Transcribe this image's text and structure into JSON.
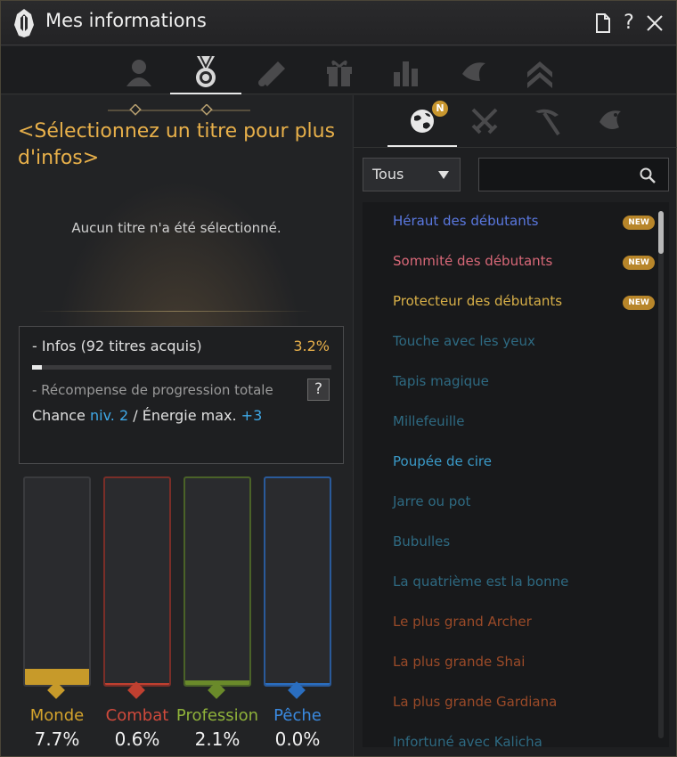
{
  "window": {
    "title": "Mes informations"
  },
  "main_tabs": [
    {
      "icon": "person-icon"
    },
    {
      "icon": "medal-icon",
      "active": true
    },
    {
      "icon": "scroll-icon"
    },
    {
      "icon": "gift-icon"
    },
    {
      "icon": "bar-chart-icon"
    },
    {
      "icon": "fish-hook-icon"
    },
    {
      "icon": "rank-chevron-icon"
    }
  ],
  "left": {
    "heading": "<Sélectionnez un titre pour plus d'infos>",
    "none_selected": "Aucun titre n'a été sélectionné.",
    "info_label": "- Infos (92 titres acquis)",
    "info_percent": "3.2%",
    "progress": 0.032,
    "reward_label": "- Récompense de progression totale",
    "help": "?",
    "reward_prefix": "Chance ",
    "reward_luck": "niv. 2",
    "reward_middle": " / Énergie max. ",
    "reward_energy": "+3"
  },
  "categories": [
    {
      "name": "Monde",
      "percent": "7.7%",
      "value": 7.7,
      "color": "#d4a32c",
      "fill": "#c79a2a",
      "border": "#3a3b3e"
    },
    {
      "name": "Combat",
      "percent": "0.6%",
      "value": 0.6,
      "color": "#d04a3c",
      "fill": "#c04030",
      "border": "#7a2e28"
    },
    {
      "name": "Profession",
      "percent": "2.1%",
      "value": 2.1,
      "color": "#8fb23a",
      "fill": "#6a8a2a",
      "border": "#4a6228"
    },
    {
      "name": "Pêche",
      "percent": "0.0%",
      "value": 0.0,
      "color": "#3a8ae0",
      "fill": "#2a6ec0",
      "border": "#2a5a9a"
    }
  ],
  "right": {
    "sub_tabs": [
      {
        "icon": "globe-icon",
        "badge": "N",
        "active": true
      },
      {
        "icon": "crossed-swords-icon"
      },
      {
        "icon": "pickaxe-icon"
      },
      {
        "icon": "fish-icon"
      }
    ],
    "filter_value": "Tous",
    "search_placeholder": "",
    "items": [
      {
        "label": "Héraut des débutants",
        "color": "#5a78e0",
        "new": "NEW"
      },
      {
        "label": "Sommité des débutants",
        "color": "#d86878",
        "new": "NEW"
      },
      {
        "label": "Protecteur des débutants",
        "color": "#d8b048",
        "new": "NEW"
      },
      {
        "label": "Touche avec les yeux",
        "color": "#2e6a82"
      },
      {
        "label": "Tapis magique",
        "color": "#2e6a82"
      },
      {
        "label": "Millefeuille",
        "color": "#2e6a82"
      },
      {
        "label": "Poupée de cire",
        "color": "#3a9ac8"
      },
      {
        "label": "Jarre ou pot",
        "color": "#2e6a82"
      },
      {
        "label": "Bubulles",
        "color": "#2e6a82"
      },
      {
        "label": "La quatrième est la bonne",
        "color": "#2e6a82"
      },
      {
        "label": "Le plus grand Archer",
        "color": "#9a4a28"
      },
      {
        "label": "La plus grande Shai",
        "color": "#9a4a28"
      },
      {
        "label": "La plus grande Gardiana",
        "color": "#9a4a28"
      },
      {
        "label": "Infortuné avec Kalicha",
        "color": "#2e6a82"
      }
    ]
  }
}
